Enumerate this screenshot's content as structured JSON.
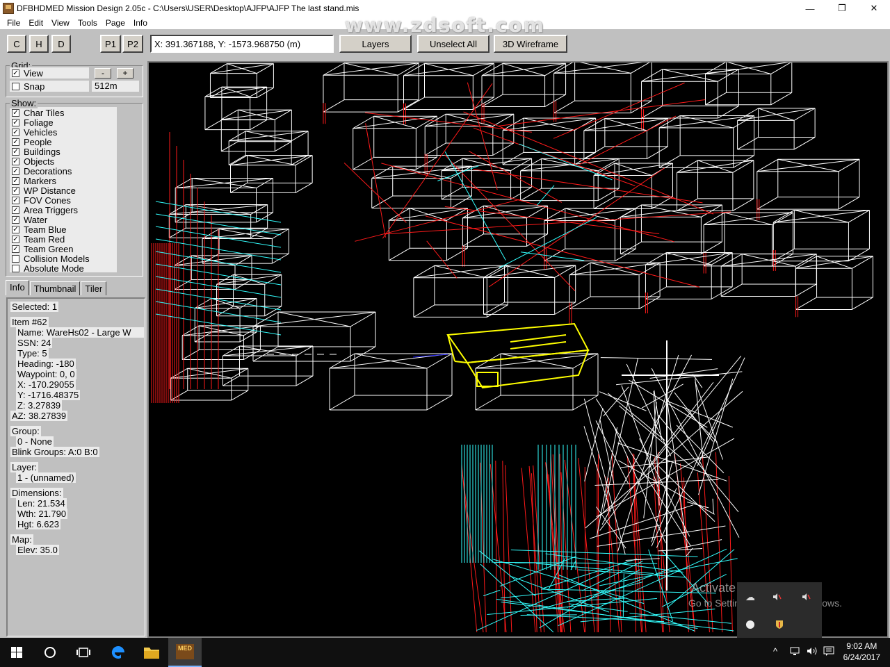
{
  "window": {
    "title": "DFBHDMED Mission Design 2.05c - C:\\Users\\USER\\Desktop\\AJFP\\AJFP The last stand.mis",
    "minimize": "—",
    "maximize": "❐",
    "close": "✕"
  },
  "menu": [
    "File",
    "Edit",
    "View",
    "Tools",
    "Page",
    "Info"
  ],
  "watermark": "www.zdsoft.com",
  "toolbar": {
    "c": "C",
    "h": "H",
    "d": "D",
    "p1": "P1",
    "p2": "P2",
    "coords": "X: 391.367188, Y: -1573.968750 (m)",
    "layers": "Layers",
    "unselect_all": "Unselect All",
    "wireframe": "3D Wireframe"
  },
  "grid": {
    "title": "Grid:",
    "view_label": "View",
    "view_checked": true,
    "minus": "-",
    "plus": "+",
    "snap_label": "Snap",
    "snap_checked": false,
    "snap_value": "512m"
  },
  "show": {
    "title": "Show:",
    "items": [
      {
        "label": "Char Tiles",
        "checked": true
      },
      {
        "label": "Foliage",
        "checked": true
      },
      {
        "label": "Vehicles",
        "checked": true
      },
      {
        "label": "People",
        "checked": true
      },
      {
        "label": "Buildings",
        "checked": true
      },
      {
        "label": "Objects",
        "checked": true
      },
      {
        "label": "Decorations",
        "checked": true
      },
      {
        "label": "Markers",
        "checked": true
      },
      {
        "label": "WP Distance",
        "checked": true
      },
      {
        "label": "FOV Cones",
        "checked": true
      },
      {
        "label": "Area Triggers",
        "checked": true
      },
      {
        "label": "Water",
        "checked": true
      },
      {
        "label": "Team Blue",
        "checked": true
      },
      {
        "label": "Team Red",
        "checked": true
      },
      {
        "label": "Team Green",
        "checked": true
      },
      {
        "label": "Collision Models",
        "checked": false
      },
      {
        "label": "Absolute Mode",
        "checked": false
      }
    ]
  },
  "tabs": [
    "Info",
    "Thumbnail",
    "Tiler"
  ],
  "info": {
    "selected": "Selected: 1",
    "item": "Item #62",
    "name": "Name: WareHs02 - Large W",
    "ssn": "SSN: 24",
    "type": "Type: 5",
    "heading": "Heading: -180",
    "waypoint": "Waypoint: 0, 0",
    "x": "X: -170.29055",
    "y": "Y: -1716.48375",
    "z": "Z: 3.27839",
    "az": "AZ: 38.27839",
    "group_label": "Group:",
    "group_value": "0 - None",
    "blink": "Blink Groups: A:0  B:0",
    "layer_label": "Layer:",
    "layer_value": "1 - (unnamed)",
    "dims_label": "Dimensions:",
    "len": "Len: 21.534",
    "wth": "Wth: 21.790",
    "hgt": "Hgt: 6.623",
    "map_label": "Map:",
    "elev": "Elev: 35.0"
  },
  "overlay": {
    "activate_1": "Activate Windows",
    "activate_2": "Go to Settings to activate Windows."
  },
  "taskbar": {
    "time": "9:02 AM",
    "date": "6/24/2017",
    "app_label": "MED",
    "tray_caret": "^"
  },
  "colors": {
    "wire_white": "#ffffff",
    "wire_red": "#ff1a1a",
    "wire_cyan": "#33ffff",
    "wire_yellow": "#ffff00"
  }
}
